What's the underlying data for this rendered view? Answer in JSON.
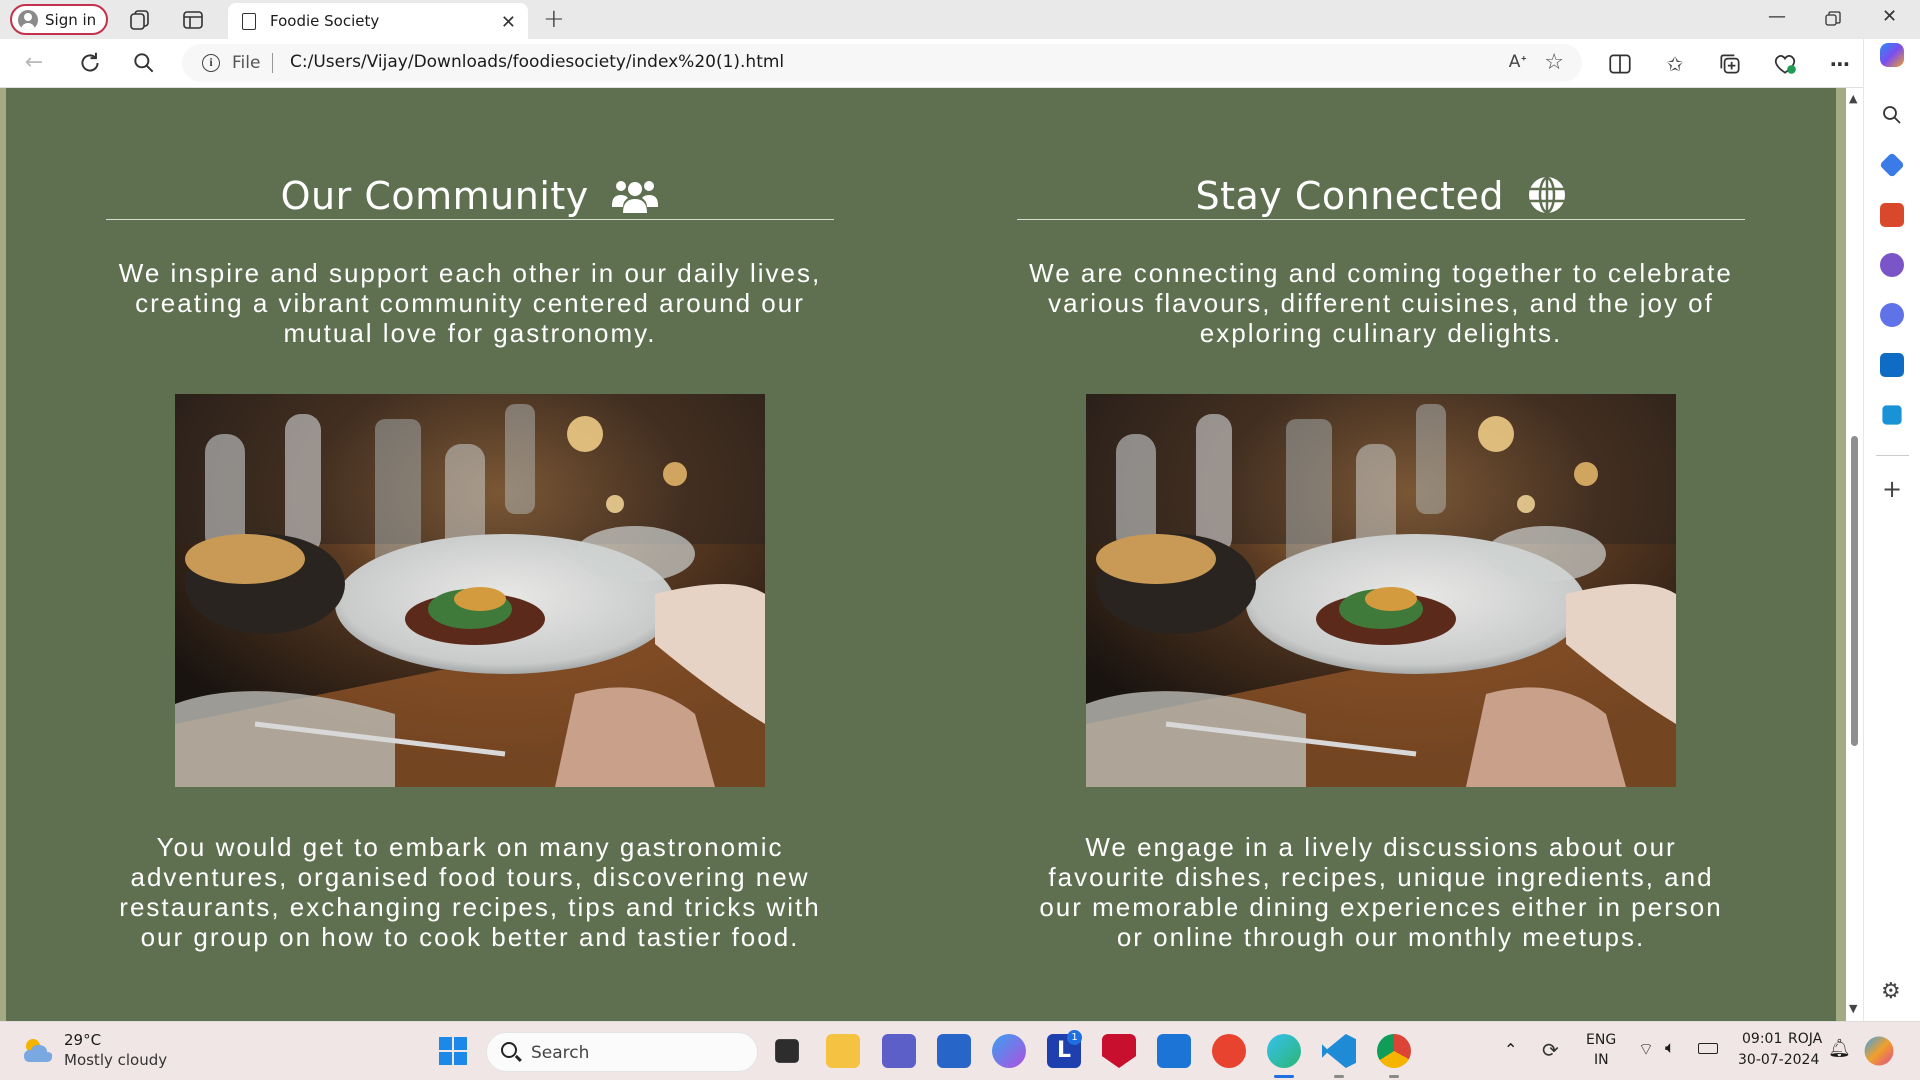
{
  "browser": {
    "sign_in_label": "Sign in",
    "tab_title": "Foodie Society",
    "address": {
      "scheme_label": "File",
      "url": "C:/Users/Vijay/Downloads/foodiesociety/index%20(1).html"
    }
  },
  "page": {
    "background": "#5f7050",
    "left": {
      "heading": "Our Community",
      "heading_icon": "users-icon",
      "intro": "We inspire and support each other in our daily lives, creating a vibrant community centered around our mutual love for gastronomy.",
      "image_icon": "dining-table-photo",
      "details": "You would get to embark on many gastronomic adventures, organised food tours, discovering new restaurants, exchanging recipes, tips and tricks with our group on how to cook better and tastier food."
    },
    "right": {
      "heading": "Stay Connected",
      "heading_icon": "globe-icon",
      "intro": "We are connecting and coming together to celebrate various flavours, different cuisines, and the joy of exploring culinary delights.",
      "image_icon": "dining-table-photo",
      "details": "We engage in a lively discussions about our favourite dishes, recipes, unique ingredients, and our memorable dining experiences either in person or online through our monthly meetups."
    }
  },
  "taskbar": {
    "weather_temp": "29°C",
    "weather_desc": "Mostly cloudy",
    "search_placeholder": "Search",
    "lang_top": "ENG",
    "lang_bottom": "IN",
    "time": "09:01",
    "user_tag": "ROJA",
    "date": "30-07-2024",
    "notification_count": "1"
  }
}
